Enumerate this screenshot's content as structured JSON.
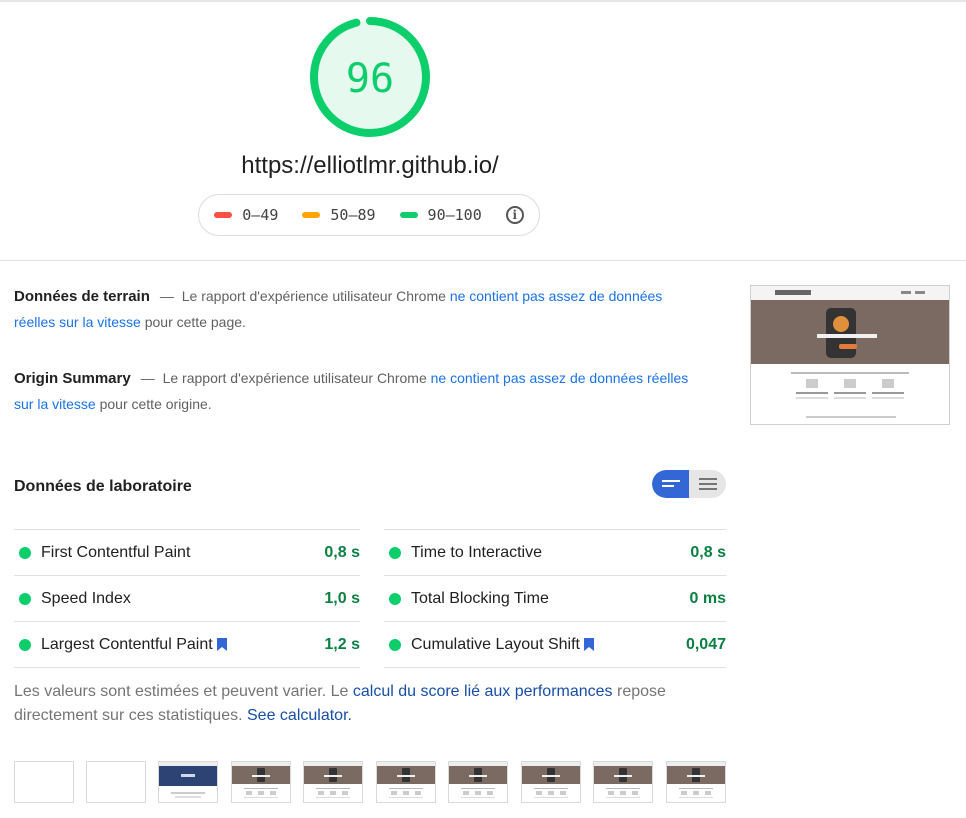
{
  "score": {
    "value": "96",
    "fraction": 0.96,
    "color": "#0cce6b",
    "fill": "#e6f9ef"
  },
  "url": "https://elliotlmr.github.io/",
  "legend": {
    "fail": {
      "label": "0–49",
      "color": "#ff4e42"
    },
    "average": {
      "label": "50–89",
      "color": "#ffa400"
    },
    "pass": {
      "label": "90–100",
      "color": "#0cce6b"
    }
  },
  "field_data": {
    "title": "Données de terrain",
    "sep": "—",
    "text_before": "Le rapport d'expérience utilisateur Chrome",
    "link": "ne contient pas assez de données réelles sur la vitesse",
    "text_after": "pour cette page."
  },
  "origin_summary": {
    "title": "Origin Summary",
    "sep": "—",
    "text_before": "Le rapport d'expérience utilisateur Chrome",
    "link": "ne contient pas assez de données réelles sur la vitesse",
    "text_after": "pour cette origine."
  },
  "lab": {
    "title": "Données de laboratoire",
    "metrics_left": [
      {
        "name": "First Contentful Paint",
        "value": "0,8 s"
      },
      {
        "name": "Speed Index",
        "value": "1,0 s"
      },
      {
        "name": "Largest Contentful Paint",
        "value": "1,2 s"
      }
    ],
    "metrics_right": [
      {
        "name": "Time to Interactive",
        "value": "0,8 s"
      },
      {
        "name": "Total Blocking Time",
        "value": "0 ms"
      },
      {
        "name": "Cumulative Layout Shift",
        "value": "0,047"
      }
    ]
  },
  "note": {
    "text1": "Les valeurs sont estimées et peuvent varier. Le",
    "link1": "calcul du score lié aux performances",
    "text2": "repose directement sur ces statistiques.",
    "link2": "See calculator."
  }
}
